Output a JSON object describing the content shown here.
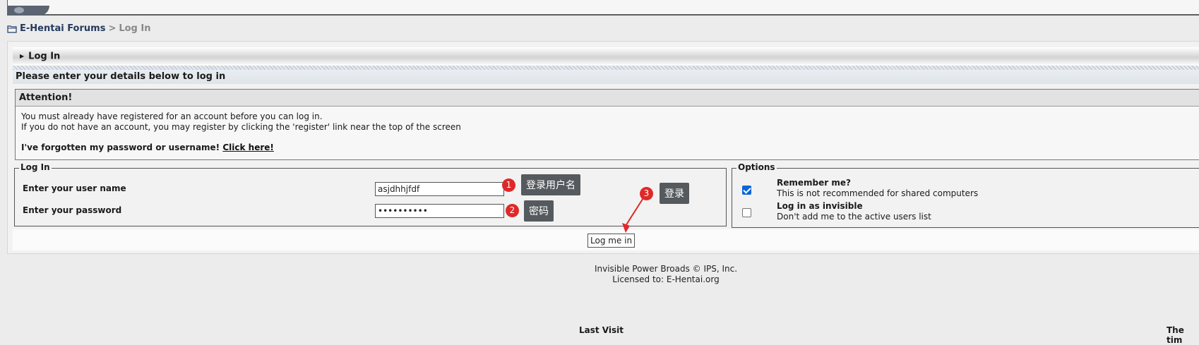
{
  "breadcrumb": {
    "forum_link": "E-Hentai Forums",
    "separator": ">",
    "current": "Log In"
  },
  "main": {
    "title": "Log In",
    "subtitle": "Please enter your details below to log in"
  },
  "attention": {
    "heading": "Attention!",
    "line1": "You must already have registered for an account before you can log in.",
    "line2": "If you do not have an account, you may register by clicking the 'register' link near the top of the screen",
    "forgot_text": "I've forgotten my password or username!",
    "forgot_link": "Click here!"
  },
  "login": {
    "legend": "Log In",
    "username_label": "Enter your user name",
    "username_value": "asjdhhjfdf",
    "password_label": "Enter your password",
    "password_value": "asjdhhjfdf"
  },
  "options": {
    "legend": "Options",
    "remember_title": "Remember me?",
    "remember_desc": "This is not recommended for shared computers",
    "remember_checked": true,
    "invisible_title": "Log in as invisible",
    "invisible_desc": "Don't add me to the active users list",
    "invisible_checked": false
  },
  "submit_label": "Log me in",
  "annotations": [
    {
      "number": "1",
      "text": "登录用户名"
    },
    {
      "number": "2",
      "text": "密码"
    },
    {
      "number": "3",
      "text": "登录"
    }
  ],
  "footer": {
    "line1": "Invisible Power Broads © IPS, Inc.",
    "line2": "Licensed to: E-Hentai.org"
  },
  "bottom_fragments": {
    "center": "Last Visit",
    "right": "The tim"
  },
  "colors": {
    "annotation_red": "#e02828",
    "tooltip_bg": "#555a5e",
    "checkbox_blue": "#0b66d6"
  }
}
